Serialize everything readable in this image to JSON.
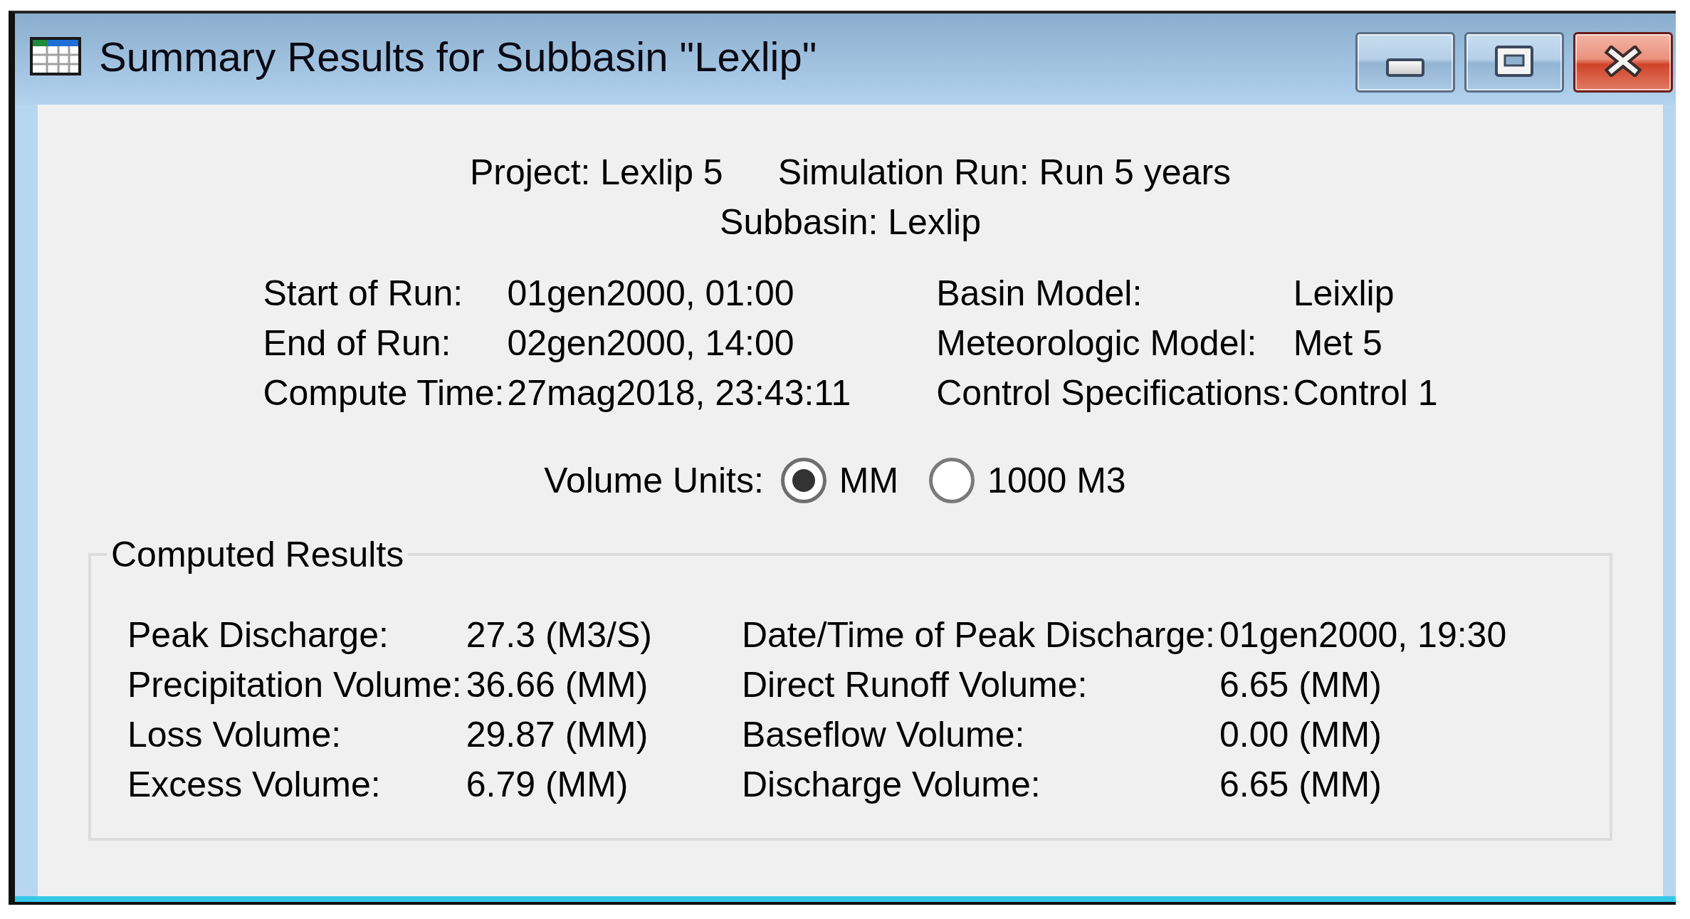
{
  "window": {
    "title": "Summary Results for Subbasin \"Lexlip\""
  },
  "header": {
    "project": "Project: Lexlip 5",
    "simulation_run": "Simulation Run: Run 5 years",
    "subbasin": "Subbasin: Lexlip"
  },
  "run_info": {
    "rows": [
      {
        "cells": [
          {
            "label": "Start of Run:",
            "value": "01gen2000, 01:00"
          },
          {
            "label": "Basin Model:",
            "value": "Leixlip"
          }
        ]
      },
      {
        "cells": [
          {
            "label": "End of Run:",
            "value": "02gen2000, 14:00"
          },
          {
            "label": "Meteorologic Model:",
            "value": "Met 5"
          }
        ]
      },
      {
        "cells": [
          {
            "label": "Compute Time:",
            "value": "27mag2018, 23:43:11"
          },
          {
            "label": "Control Specifications:",
            "value": "Control 1"
          }
        ]
      }
    ]
  },
  "volume_units": {
    "label": "Volume Units:",
    "options": [
      {
        "label": "MM",
        "selected": true
      },
      {
        "label": "1000 M3",
        "selected": false
      }
    ]
  },
  "computed_results": {
    "title": "Computed Results",
    "rows": [
      {
        "cells": [
          {
            "label": "Peak Discharge:",
            "value": "27.3 (M3/S)"
          },
          {
            "label": "Date/Time of Peak Discharge:",
            "value": "01gen2000, 19:30"
          }
        ]
      },
      {
        "cells": [
          {
            "label": "Precipitation Volume:",
            "value": "36.66 (MM)"
          },
          {
            "label": "Direct Runoff Volume:",
            "value": "6.65 (MM)"
          }
        ]
      },
      {
        "cells": [
          {
            "label": "Loss Volume:",
            "value": "29.87 (MM)"
          },
          {
            "label": "Baseflow Volume:",
            "value": "0.00 (MM)"
          }
        ]
      },
      {
        "cells": [
          {
            "label": "Excess Volume:",
            "value": "6.79 (MM)"
          },
          {
            "label": "Discharge Volume:",
            "value": "6.65 (MM)"
          }
        ]
      }
    ]
  }
}
